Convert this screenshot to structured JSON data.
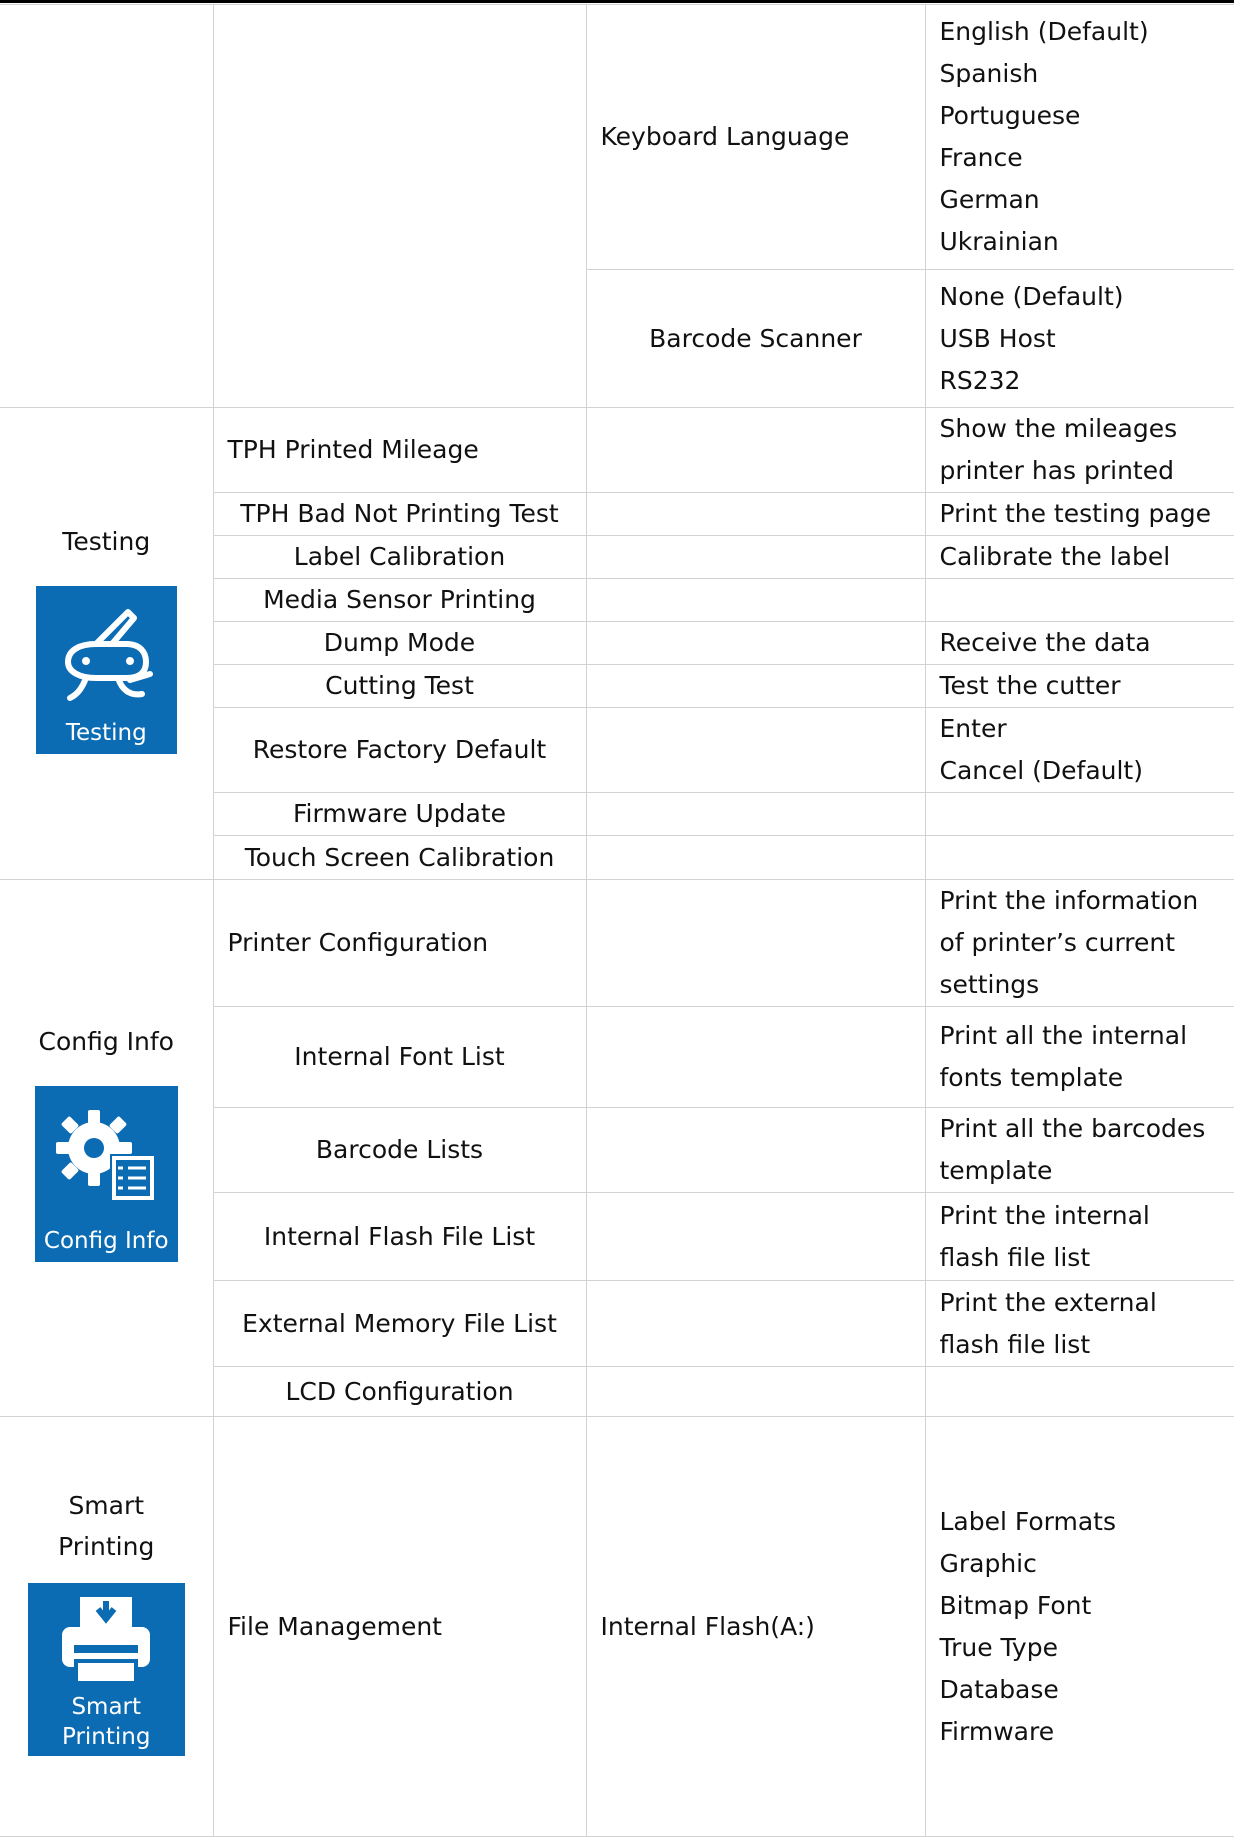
{
  "colors": {
    "icon_bg": "#0b6cb4",
    "border": "#d3d3d3",
    "text": "#111111"
  },
  "rows_top": {
    "keyboard": {
      "setting": "Keyboard Language",
      "options": [
        "English (Default)",
        "Spanish",
        "Portuguese",
        "France",
        "German",
        "Ukrainian"
      ]
    },
    "scanner": {
      "setting": "Barcode Scanner",
      "options": [
        "None (Default)",
        "USB Host",
        "RS232"
      ]
    }
  },
  "testing": {
    "category": "Testing",
    "icon_label": "Testing",
    "icon_name": "swiss-knife-icon",
    "items": [
      {
        "name": "TPH Printed Mileage",
        "desc": [
          "Show the mileages",
          "printer has printed"
        ]
      },
      {
        "name": "TPH Bad Not Printing Test",
        "desc": [
          "Print the testing page"
        ]
      },
      {
        "name": "Label Calibration",
        "desc": [
          "Calibrate the label"
        ]
      },
      {
        "name": "Media Sensor Printing",
        "desc": []
      },
      {
        "name": "Dump Mode",
        "desc": [
          "Receive the data"
        ]
      },
      {
        "name": "Cutting Test",
        "desc": [
          "Test the cutter"
        ]
      },
      {
        "name": "Restore Factory Default",
        "desc": [
          "Enter",
          "Cancel (Default)"
        ]
      },
      {
        "name": "Firmware Update",
        "desc": []
      },
      {
        "name": "Touch Screen Calibration",
        "desc": []
      }
    ]
  },
  "config": {
    "category": "Config Info",
    "icon_label": "Config Info",
    "icon_name": "gear-checklist-icon",
    "items": [
      {
        "name": "Printer Configuration",
        "desc": [
          "Print the information",
          "of printer’s current",
          "settings"
        ]
      },
      {
        "name": "Internal Font List",
        "desc": [
          "Print all the internal",
          "fonts template"
        ]
      },
      {
        "name": "Barcode Lists",
        "desc": [
          "Print all the barcodes",
          "template"
        ]
      },
      {
        "name": "Internal Flash File List",
        "desc": [
          "Print the internal",
          "flash file list"
        ]
      },
      {
        "name": "External Memory File List",
        "desc": [
          "Print the external",
          "flash file list"
        ]
      },
      {
        "name": "LCD Configuration",
        "desc": []
      }
    ]
  },
  "smart": {
    "category_lines": [
      "Smart",
      "Printing"
    ],
    "icon_label_lines": [
      "Smart",
      "Printing"
    ],
    "icon_name": "printer-icon",
    "item": {
      "name": "File Management",
      "setting": "Internal Flash(A:)",
      "options": [
        "Label Formats",
        "Graphic",
        "Bitmap Font",
        "True Type",
        "Database",
        "Firmware"
      ]
    }
  }
}
